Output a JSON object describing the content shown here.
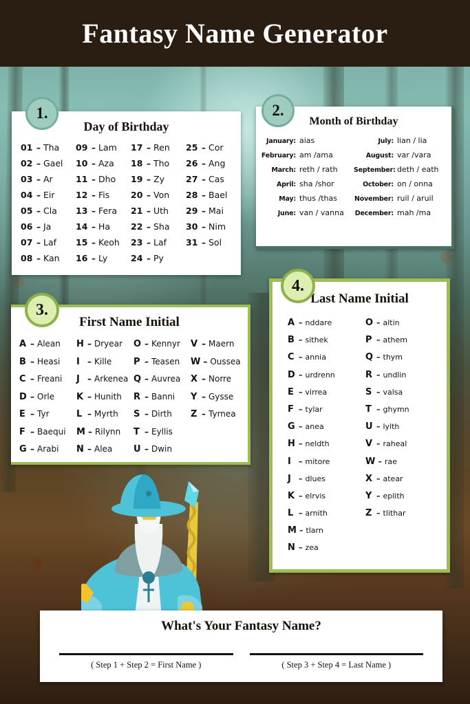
{
  "header": {
    "title": "Fantasy Name Generator"
  },
  "cards": [
    {
      "badge": "1.",
      "title": "Day of Birthday",
      "columns": [
        [
          {
            "k": "01",
            "v": "Tha"
          },
          {
            "k": "02",
            "v": "Gael"
          },
          {
            "k": "03",
            "v": "Ar"
          },
          {
            "k": "04",
            "v": "Eir"
          },
          {
            "k": "05",
            "v": "Cla"
          },
          {
            "k": "06",
            "v": "Ja"
          },
          {
            "k": "07",
            "v": "Laf"
          },
          {
            "k": "08",
            "v": "Kan"
          }
        ],
        [
          {
            "k": "09",
            "v": "Lam"
          },
          {
            "k": "10",
            "v": "Aza"
          },
          {
            "k": "11",
            "v": "Dho"
          },
          {
            "k": "12",
            "v": "Fis"
          },
          {
            "k": "13",
            "v": "Fera"
          },
          {
            "k": "14",
            "v": "Ha"
          },
          {
            "k": "15",
            "v": "Keoh"
          },
          {
            "k": "16",
            "v": "Ly"
          }
        ],
        [
          {
            "k": "17",
            "v": "Ren"
          },
          {
            "k": "18",
            "v": "Tho"
          },
          {
            "k": "19",
            "v": "Zy"
          },
          {
            "k": "20",
            "v": "Von"
          },
          {
            "k": "21",
            "v": "Uth"
          },
          {
            "k": "22",
            "v": "Sha"
          },
          {
            "k": "23",
            "v": "Laf"
          },
          {
            "k": "24",
            "v": "Py"
          }
        ],
        [
          {
            "k": "25",
            "v": "Cor"
          },
          {
            "k": "26",
            "v": "Ang"
          },
          {
            "k": "27",
            "v": "Cas"
          },
          {
            "k": "28",
            "v": "Bael"
          },
          {
            "k": "29",
            "v": "Mai"
          },
          {
            "k": "30",
            "v": "Nim"
          },
          {
            "k": "31",
            "v": "Sol"
          }
        ]
      ]
    },
    {
      "badge": "2.",
      "title": "Month of Birthday",
      "columns": [
        [
          {
            "k": "January:",
            "v": "aias"
          },
          {
            "k": "February:",
            "v": "am /ama"
          },
          {
            "k": "March:",
            "v": "reth / rath"
          },
          {
            "k": "April:",
            "v": "sha /shor"
          },
          {
            "k": "May:",
            "v": "thus /thas"
          },
          {
            "k": "June:",
            "v": "van / vanna"
          }
        ],
        [
          {
            "k": "July:",
            "v": "lian / lia"
          },
          {
            "k": "August:",
            "v": "var /vara"
          },
          {
            "k": "September:",
            "v": "deth / eath"
          },
          {
            "k": "October:",
            "v": "on / onna"
          },
          {
            "k": "November:",
            "v": "ruil  / aruil"
          },
          {
            "k": "December:",
            "v": "mah /ma"
          }
        ]
      ]
    },
    {
      "badge": "3.",
      "title": "First Name Initial",
      "columns": [
        [
          {
            "k": "A",
            "v": "Alean"
          },
          {
            "k": "B",
            "v": "Heasi"
          },
          {
            "k": "C",
            "v": "Freani"
          },
          {
            "k": "D",
            "v": "Orle"
          },
          {
            "k": "E",
            "v": "Tyr"
          },
          {
            "k": "F",
            "v": "Baequi"
          },
          {
            "k": "G",
            "v": "Arabi"
          }
        ],
        [
          {
            "k": "H",
            "v": "Dryear"
          },
          {
            "k": "I",
            "v": "Kille"
          },
          {
            "k": "J",
            "v": "Arkenea"
          },
          {
            "k": "K",
            "v": "Hunith"
          },
          {
            "k": "L",
            "v": "Myrth"
          },
          {
            "k": "M",
            "v": "Rilynn"
          },
          {
            "k": "N",
            "v": "Alea"
          }
        ],
        [
          {
            "k": "O",
            "v": "Kennyr"
          },
          {
            "k": "P",
            "v": "Teasen"
          },
          {
            "k": "Q",
            "v": "Auvrea"
          },
          {
            "k": "R",
            "v": "Banni"
          },
          {
            "k": "S",
            "v": "Dirth"
          },
          {
            "k": "T",
            "v": "Eyllis"
          },
          {
            "k": "U",
            "v": "Dwin"
          }
        ],
        [
          {
            "k": "V",
            "v": "Maern"
          },
          {
            "k": "W",
            "v": "Oussea"
          },
          {
            "k": "X",
            "v": "Norre"
          },
          {
            "k": "Y",
            "v": "Gysse"
          },
          {
            "k": "Z",
            "v": "Tyrnea"
          }
        ]
      ]
    },
    {
      "badge": "4.",
      "title": "Last Name Initial",
      "columns": [
        [
          {
            "k": "A",
            "v": "nddare"
          },
          {
            "k": "B",
            "v": "sithek"
          },
          {
            "k": "C",
            "v": "annia"
          },
          {
            "k": "D",
            "v": "urdrenn"
          },
          {
            "k": "E",
            "v": "virrea"
          },
          {
            "k": "F",
            "v": "tylar"
          },
          {
            "k": "G",
            "v": "anea"
          },
          {
            "k": "H",
            "v": "neldth"
          },
          {
            "k": "I",
            "v": "mitore"
          },
          {
            "k": "J",
            "v": "dlues"
          },
          {
            "k": "K",
            "v": "elrvis"
          },
          {
            "k": "L",
            "v": "arnith"
          },
          {
            "k": "M",
            "v": "tlarn"
          },
          {
            "k": "N",
            "v": "zea"
          }
        ],
        [
          {
            "k": "O",
            "v": "altin"
          },
          {
            "k": "P",
            "v": "athem"
          },
          {
            "k": "Q",
            "v": "thym"
          },
          {
            "k": "R",
            "v": "undlin"
          },
          {
            "k": "S",
            "v": "valsa"
          },
          {
            "k": "T",
            "v": "ghymn"
          },
          {
            "k": "U",
            "v": "lylth"
          },
          {
            "k": "V",
            "v": "raheal"
          },
          {
            "k": "W",
            "v": "rae"
          },
          {
            "k": "X",
            "v": "atear"
          },
          {
            "k": "Y",
            "v": "eplith"
          },
          {
            "k": "Z",
            "v": "tlithar"
          }
        ]
      ]
    }
  ],
  "answer": {
    "title": "What's Your Fantasy Name?",
    "blank_first_label": "( Step 1 + Step 2 = First Name )",
    "blank_last_label": "( Step 3 + Step 4 = Last Name )"
  },
  "colors": {
    "header_bg": "#2a1d12",
    "badge_teal": "#9ecdc0",
    "badge_teal_border": "#76ada1",
    "badge_green": "#dcefb0",
    "badge_green_border": "#8fb14a",
    "card_border_green": "#9dbf52",
    "wizard_robe": "#4ec3d8",
    "wizard_staff": "#e8c93c"
  }
}
